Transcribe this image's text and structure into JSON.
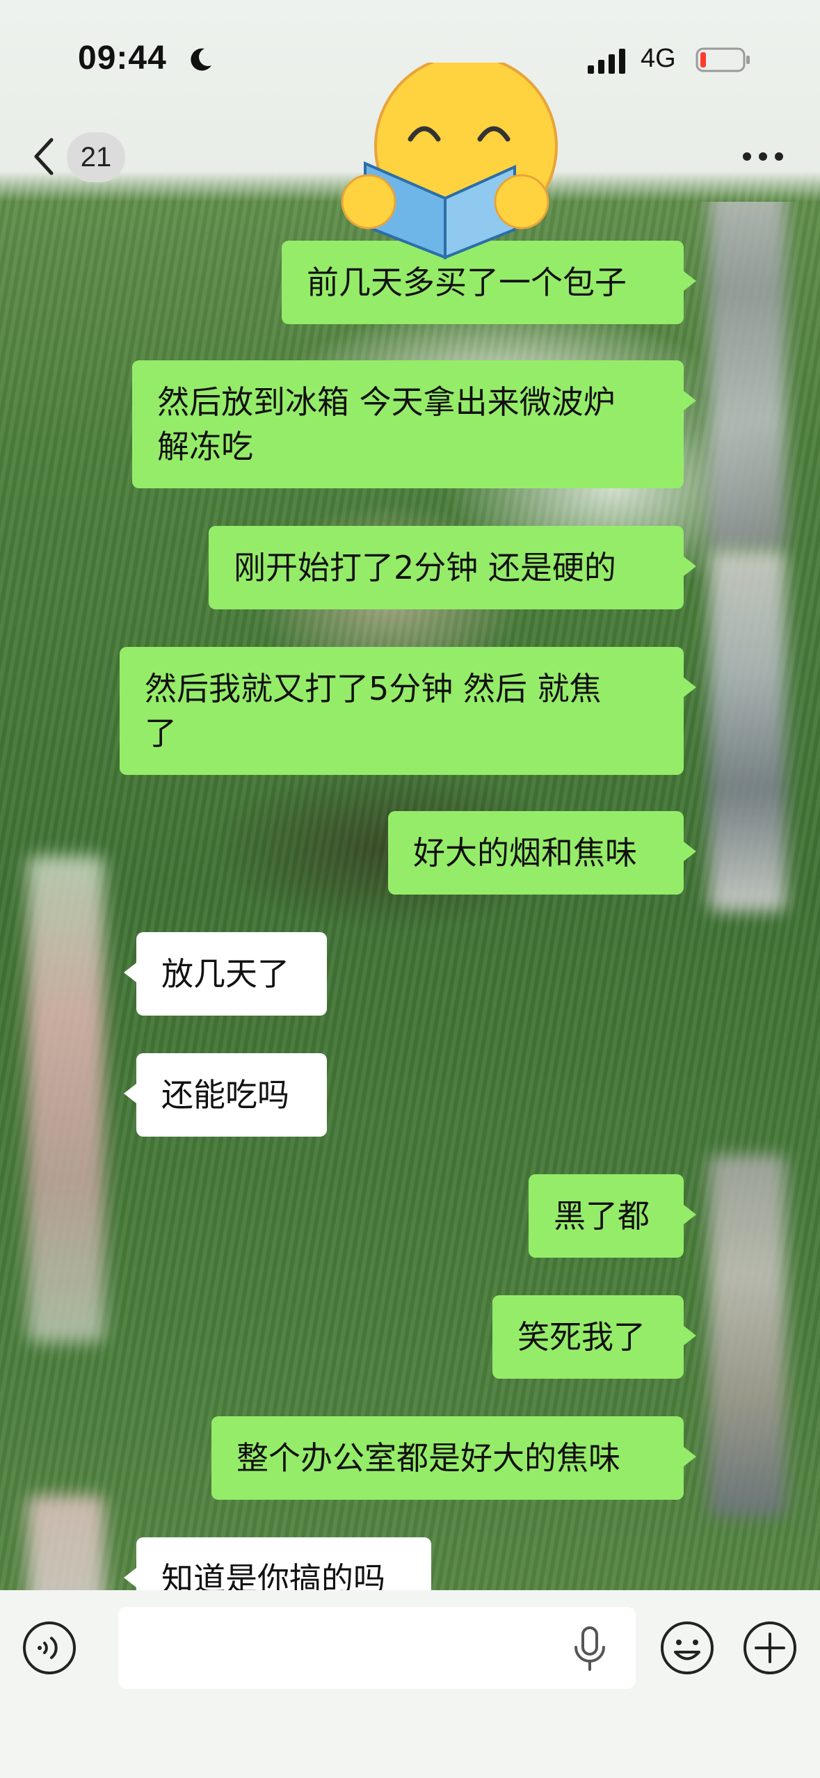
{
  "status_bar": {
    "time": "09:44",
    "network": "4G"
  },
  "nav": {
    "unread_count": "21"
  },
  "messages": [
    {
      "side": "out",
      "text": "前几天多买了一个包子"
    },
    {
      "side": "out",
      "text": "然后放到冰箱 今天拿出来微波炉\n解冻吃"
    },
    {
      "side": "out",
      "text": "刚开始打了2分钟 还是硬的"
    },
    {
      "side": "out",
      "text": "然后我就又打了5分钟  然后 就焦\n了"
    },
    {
      "side": "out",
      "text": "好大的烟和焦味"
    },
    {
      "side": "in",
      "text": "放几天了"
    },
    {
      "side": "in",
      "text": "还能吃吗"
    },
    {
      "side": "out",
      "text": "黑了都"
    },
    {
      "side": "out",
      "text": "笑死我了"
    },
    {
      "side": "out",
      "text": "整个办公室都是好大的焦味"
    },
    {
      "side": "in",
      "text": "知道是你搞的吗"
    }
  ],
  "colors": {
    "outgoing_bubble": "#95ec69",
    "incoming_bubble": "#ffffff",
    "battery_low": "#ff3b30"
  },
  "icons": [
    "back-icon",
    "more-icon",
    "voice-icon",
    "mic-icon",
    "emoji-icon",
    "plus-icon",
    "moon-icon",
    "signal-icon",
    "battery-icon",
    "sticker-reading-emoji"
  ]
}
